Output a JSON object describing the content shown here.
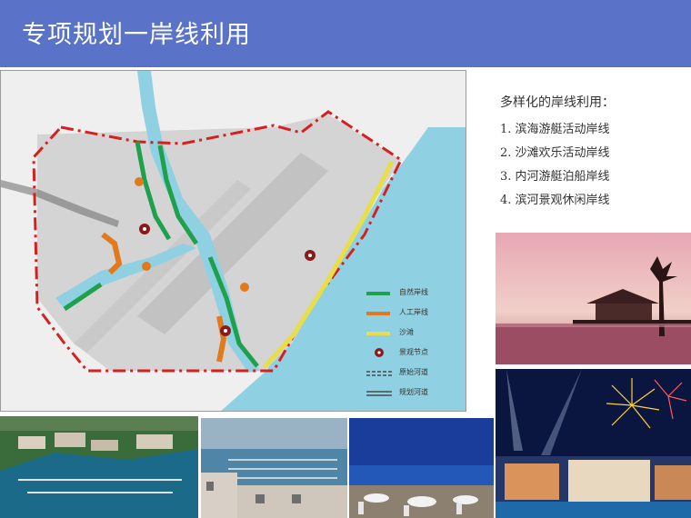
{
  "header": {
    "title": "专项规划一岸线利用",
    "bg_color": "#5a72c7"
  },
  "shoreline_usage": {
    "title": "多样化的岸线利用：",
    "items": [
      "1. 滨海游艇活动岸线",
      "2. 沙滩欢乐活动岸线",
      "3. 内河游艇泊船岸线",
      "4. 滨河景观休闲岸线"
    ]
  },
  "map": {
    "legend": [
      {
        "label": "自然岸线",
        "color": "#1fa04a",
        "kind": "solid"
      },
      {
        "label": "人工岸线",
        "color": "#e07a1c",
        "kind": "solid"
      },
      {
        "label": "沙滩",
        "color": "#e8de48",
        "kind": "solid"
      },
      {
        "label": "景观节点",
        "color": "#8b1a1a",
        "kind": "node"
      },
      {
        "label": "原始河道",
        "color": "#333333",
        "kind": "dashed"
      },
      {
        "label": "规划河道",
        "color": "#333333",
        "kind": "double"
      }
    ],
    "colors": {
      "sea": "#8fd1e3",
      "land": "#dcdcdc",
      "boundary": "#d6201f",
      "natural_shore": "#1fa04a",
      "artificial_shore": "#e07a1c",
      "beach": "#e8de48"
    }
  },
  "photos": [
    {
      "name": "sunset-pavilion-photo"
    },
    {
      "name": "fireworks-night-photo"
    },
    {
      "name": "marina-aerial-photo"
    },
    {
      "name": "yacht-harbor-photo"
    },
    {
      "name": "seaside-terrace-photo"
    }
  ]
}
